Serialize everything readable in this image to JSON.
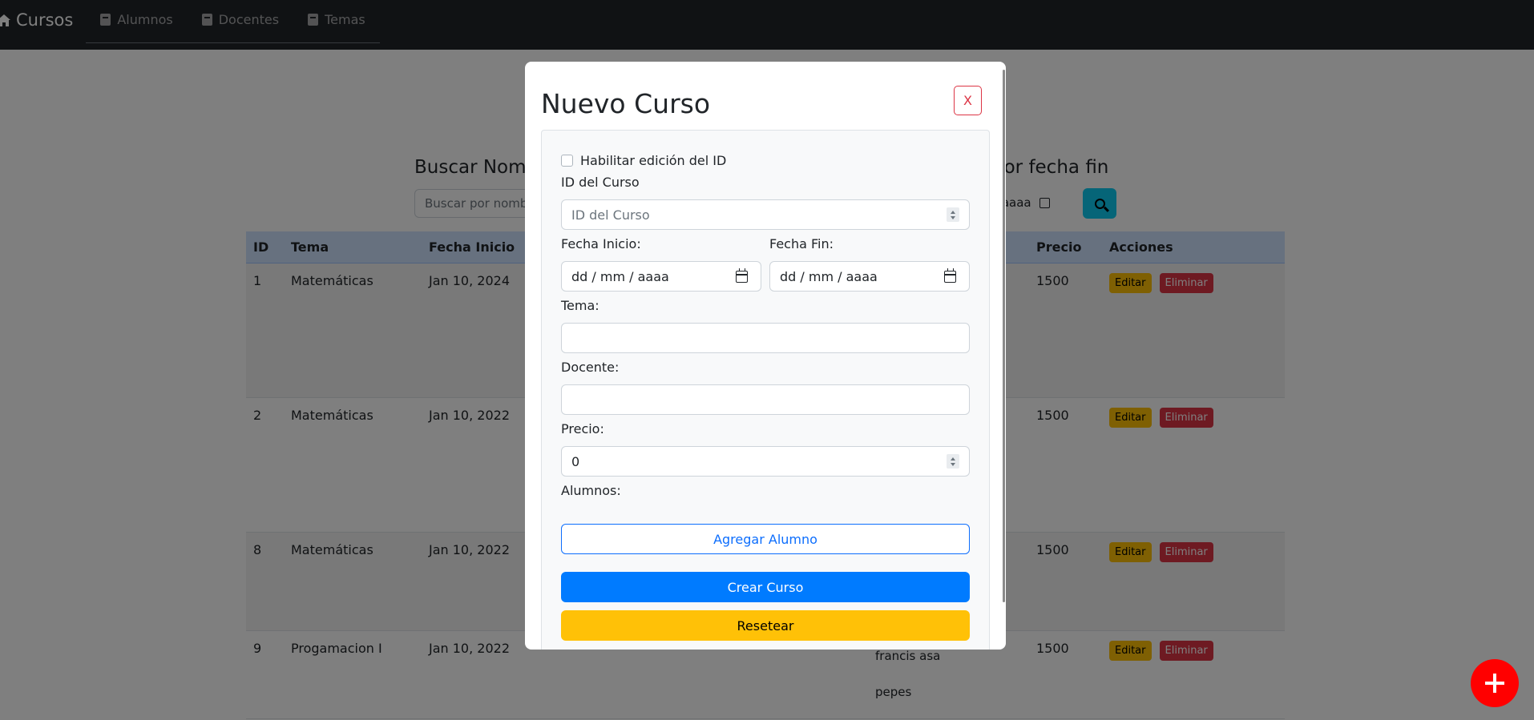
{
  "navbar": {
    "brand": "Cursos",
    "links": [
      "Alumnos",
      "Docentes",
      "Temas"
    ]
  },
  "search": {
    "label_left": "Buscar Nomb",
    "label_right": "por fecha fin",
    "name_placeholder": "Buscar por nombre",
    "date_value": "/ aaaa"
  },
  "table": {
    "headers": [
      "ID",
      "Tema",
      "Fecha Inicio",
      "Precio",
      "Acciones"
    ],
    "rows": [
      {
        "id": "1",
        "tema": "Matemáticas",
        "fecha_inicio": "Jan 10, 2024",
        "precio": "1500"
      },
      {
        "id": "2",
        "tema": "Matemáticas",
        "fecha_inicio": "Jan 10, 2022",
        "precio": "1500"
      },
      {
        "id": "8",
        "tema": "Matemáticas",
        "fecha_inicio": "Jan 10, 2022",
        "precio": "1500"
      },
      {
        "id": "9",
        "tema": "Progamacion I",
        "fecha_inicio": "Jan 10, 2022",
        "precio": "1500"
      }
    ],
    "alumnos_visible": [
      "francis asa",
      "pepes"
    ],
    "edit_label": "Editar",
    "delete_label": "Eliminar"
  },
  "modal": {
    "title": "Nuevo Curso",
    "close_label": "X",
    "habilitar_id_label": "Habilitar edición del ID",
    "id_label": "ID del Curso",
    "id_placeholder": "ID del Curso",
    "fecha_inicio_label": "Fecha Inicio:",
    "fecha_inicio_placeholder": "dd / mm / aaaa",
    "fecha_fin_label": "Fecha Fin:",
    "fecha_fin_placeholder": "dd / mm / aaaa",
    "tema_label": "Tema:",
    "tema_value": "",
    "docente_label": "Docente:",
    "docente_value": "",
    "precio_label": "Precio:",
    "precio_value": "0",
    "alumnos_label": "Alumnos:",
    "agregar_alumno_label": "Agregar Alumno",
    "crear_curso_label": "Crear Curso",
    "resetear_label": "Resetear"
  },
  "colors": {
    "navbar": "#212529",
    "primary": "#007bff",
    "warning": "#ffc107",
    "danger": "#dc3545",
    "fab": "#ff0000"
  }
}
